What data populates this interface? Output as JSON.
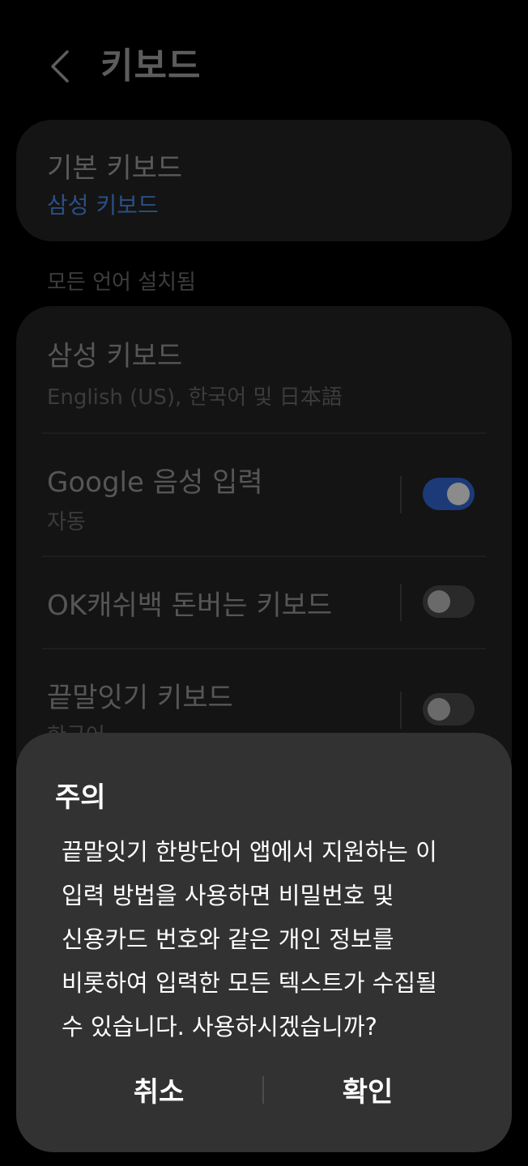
{
  "header": {
    "back_icon": "chevron-left-icon",
    "title": "키보드"
  },
  "default_keyboard": {
    "title": "기본 키보드",
    "value": "삼성 키보드"
  },
  "section_label": "모든 언어 설치됨",
  "keyboards": [
    {
      "title": "삼성 키보드",
      "subtitle": "English (US), 한국어 및 日本語"
    },
    {
      "title": "Google 음성 입력",
      "subtitle": "자동",
      "toggle": "on"
    },
    {
      "title": "OK캐쉬백 돈버는 키보드",
      "toggle": "off"
    },
    {
      "title": "끝말잇기 키보드",
      "subtitle": "한국어",
      "toggle": "off"
    }
  ],
  "dialog": {
    "title": "주의",
    "body_lines": [
      "끝말잇기 한방단어 앱에서 지원하는 이",
      "입력 방법을 사용하면 비밀번호 및",
      "신용카드 번호와 같은 개인 정보를",
      "비롯하여 입력한 모든 텍스트가 수집될",
      "수 있습니다. 사용하시겠습니까?"
    ],
    "cancel_label": "취소",
    "ok_label": "확인"
  },
  "colors": {
    "accent_blue": "#2a4f86",
    "toggle_on": "#1d3a78",
    "dialog_bg": "#323232"
  }
}
